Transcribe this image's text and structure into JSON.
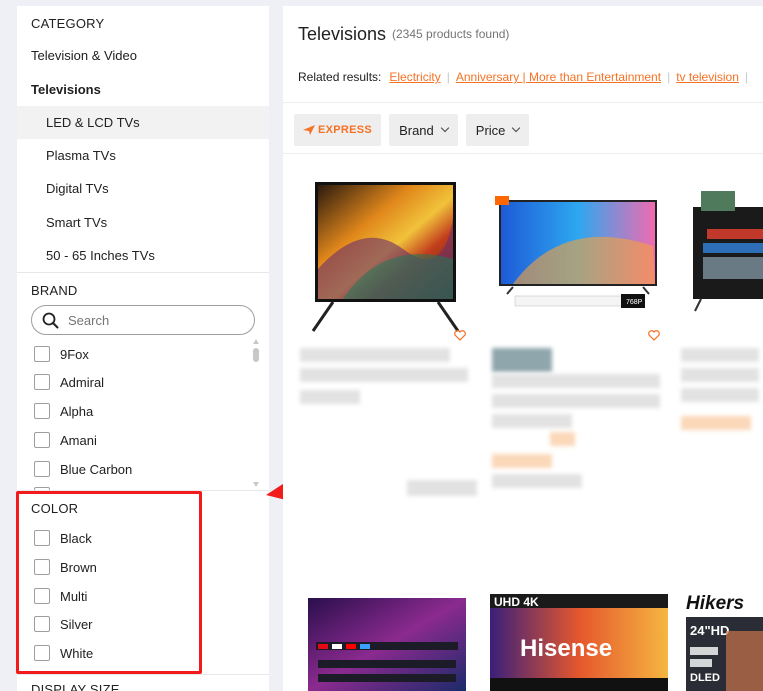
{
  "category": {
    "title": "CATEGORY",
    "items": [
      {
        "label": "Television & Video"
      },
      {
        "label": "Televisions"
      },
      {
        "label": "LED & LCD TVs"
      },
      {
        "label": "Plasma TVs"
      },
      {
        "label": "Digital TVs"
      },
      {
        "label": "Smart TVs"
      },
      {
        "label": "50 - 65 Inches TVs"
      }
    ]
  },
  "brand": {
    "title": "BRAND",
    "search_placeholder": "Search",
    "options": [
      "9Fox",
      "Admiral",
      "Alpha",
      "Amani",
      "Blue Carbon"
    ]
  },
  "color": {
    "title": "COLOR",
    "options": [
      "Black",
      "Brown",
      "Multi",
      "Silver",
      "White"
    ]
  },
  "display_size": {
    "title": "DISPLAY SIZE"
  },
  "main": {
    "title": "Televisions",
    "count_text": "(2345 products found)",
    "related_label": "Related results:",
    "related_links": [
      "Electricity",
      "Anniversary | More than Entertainment",
      "tv television"
    ],
    "filters": {
      "express": "EXPRESS",
      "brand": "Brand",
      "price": "Price"
    }
  },
  "products": {
    "p4_badge": "UHD 4K",
    "p4_brand": "Hisense",
    "p5_brand": "Hikers",
    "p5_size": "24\"HD",
    "p5_tag": "DLED",
    "p2_tag": "768P"
  },
  "colors": {
    "accent": "#f57224",
    "highlight": "#f21b1b"
  },
  "icons": [
    "search-icon",
    "chevron-down-icon",
    "heart-icon",
    "express-logo-icon"
  ]
}
